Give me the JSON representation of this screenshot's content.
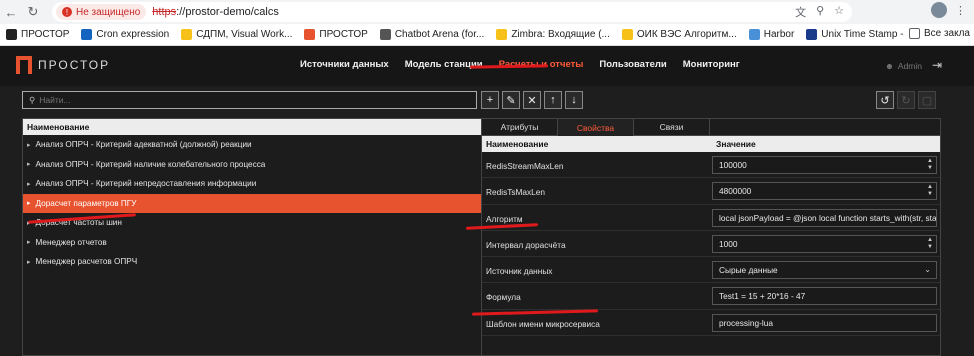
{
  "browser": {
    "warning": "Не защищено",
    "url_scheme": "https",
    "url_rest": "://prostor-demo/calcs",
    "bookmarks": [
      {
        "label": "ПРОСТОР",
        "color": "#222222"
      },
      {
        "label": "Cron expression",
        "color": "#1565c0"
      },
      {
        "label": "СДПМ, Visual Work...",
        "color": "#f6c21a"
      },
      {
        "label": "ПРОСТОР",
        "color": "#e8532f"
      },
      {
        "label": "Chatbot Arena (for...",
        "color": "#555555"
      },
      {
        "label": "Zimbra: Входящие (...",
        "color": "#f6c21a"
      },
      {
        "label": "ОИК ВЭС Алгоритм...",
        "color": "#f6c21a"
      },
      {
        "label": "Harbor",
        "color": "#4a90d9"
      },
      {
        "label": "Unix Time Stamp - E...",
        "color": "#1a3a8a"
      }
    ],
    "all_bookmarks": "Все закла"
  },
  "app": {
    "logo": "ПРОСТОР",
    "menu": [
      {
        "label": "Источники данных",
        "active": false
      },
      {
        "label": "Модель станции",
        "active": false
      },
      {
        "label": "Расчеты и отчеты",
        "active": true
      },
      {
        "label": "Пользователи",
        "active": false
      },
      {
        "label": "Мониторинг",
        "active": false
      }
    ],
    "user": "Admin",
    "accent": "#e8532f"
  },
  "search": {
    "placeholder": "Найти..."
  },
  "tree": {
    "header": "Наименование",
    "items": [
      {
        "label": "Анализ ОПРЧ - Критерий адекватной (должной) реакции",
        "selected": false
      },
      {
        "label": "Анализ ОПРЧ - Критерий наличие колебательного процесса",
        "selected": false
      },
      {
        "label": "Анализ ОПРЧ - Критерий непредоставления информации",
        "selected": false
      },
      {
        "label": "Дорасчет параметров ПГУ",
        "selected": true
      },
      {
        "label": "Дорасчет частоты шин",
        "selected": false
      },
      {
        "label": "Менеджер отчетов",
        "selected": false
      },
      {
        "label": "Менеджер расчетов ОПРЧ",
        "selected": false
      }
    ]
  },
  "tabs": [
    {
      "label": "Атрибуты",
      "active": false
    },
    {
      "label": "Свойства",
      "active": true
    },
    {
      "label": "Связи",
      "active": false
    }
  ],
  "props": {
    "col_name": "Наименование",
    "col_value": "Значение",
    "rows": [
      {
        "name": "RedisStreamMaxLen",
        "value": "100000",
        "kind": "spin"
      },
      {
        "name": "RedisTsMaxLen",
        "value": "4800000",
        "kind": "spin"
      },
      {
        "name": "Алгоритм",
        "value": "local jsonPayload = @json  local function starts_with(str, star",
        "kind": "text"
      },
      {
        "name": "Интервал дорасчёта",
        "value": "1000",
        "kind": "spin"
      },
      {
        "name": "Источник данных",
        "value": "Сырые данные",
        "kind": "select"
      },
      {
        "name": "Формула",
        "value": "Test1 = 15 + 20*16 - 47",
        "kind": "text"
      },
      {
        "name": "Шаблон имени микросервиса",
        "value": "processing-lua",
        "kind": "text"
      }
    ]
  }
}
